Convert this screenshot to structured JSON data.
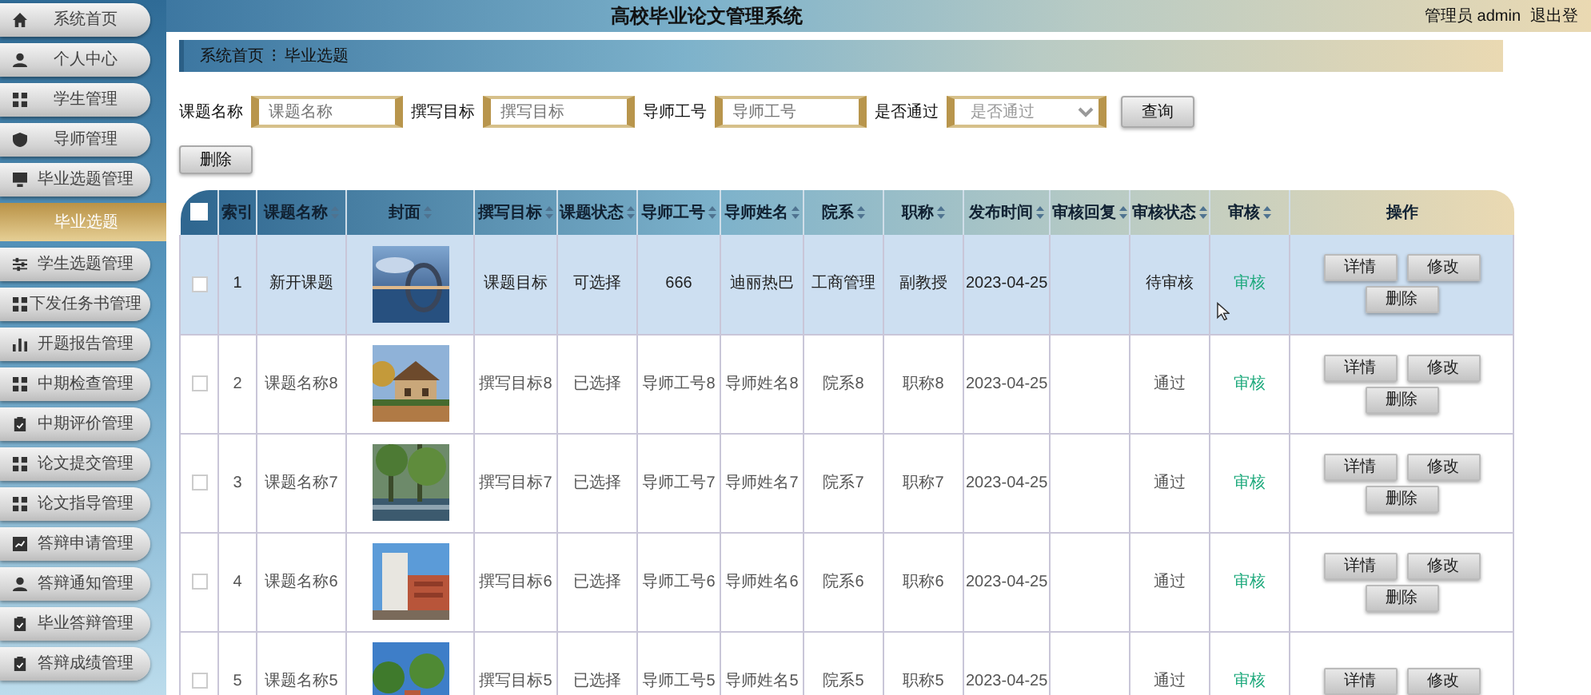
{
  "header": {
    "title": "高校毕业论文管理系统",
    "user": "管理员 admin",
    "logout": "退出登"
  },
  "sidebar": {
    "items": [
      {
        "label": "系统首页",
        "selected": false
      },
      {
        "label": "个人中心",
        "selected": false
      },
      {
        "label": "学生管理",
        "selected": false
      },
      {
        "label": "导师管理",
        "selected": false
      },
      {
        "label": "毕业选题管理",
        "selected": false
      },
      {
        "label": "毕业选题",
        "selected": true
      },
      {
        "label": "学生选题管理",
        "selected": false
      },
      {
        "label": "下发任务书管理",
        "selected": false
      },
      {
        "label": "开题报告管理",
        "selected": false
      },
      {
        "label": "中期检查管理",
        "selected": false
      },
      {
        "label": "中期评价管理",
        "selected": false
      },
      {
        "label": "论文提交管理",
        "selected": false
      },
      {
        "label": "论文指导管理",
        "selected": false
      },
      {
        "label": "答辩申请管理",
        "selected": false
      },
      {
        "label": "答辩通知管理",
        "selected": false
      },
      {
        "label": "毕业答辩管理",
        "selected": false
      },
      {
        "label": "答辩成绩管理",
        "selected": false
      }
    ]
  },
  "breadcrumb": {
    "items": [
      "系统首页",
      "毕业选题"
    ],
    "separator": "⁝"
  },
  "search": {
    "fields": [
      {
        "kind": "input",
        "label": "课题名称",
        "placeholder": "课题名称"
      },
      {
        "kind": "input",
        "label": "撰写目标",
        "placeholder": "撰写目标"
      },
      {
        "kind": "input",
        "label": "导师工号",
        "placeholder": "导师工号"
      },
      {
        "kind": "select",
        "label": "是否通过",
        "placeholder": "是否通过"
      }
    ],
    "button": "查询"
  },
  "delete_button": "删除",
  "table": {
    "header_checked": false,
    "columns": [
      {
        "kind": "checkbox"
      },
      {
        "kind": "text",
        "label": "索引",
        "sortable": false
      },
      {
        "kind": "text",
        "label": "课题名称",
        "sortable": true
      },
      {
        "kind": "picture",
        "label": "封面",
        "sortable": true
      },
      {
        "kind": "text",
        "label": "撰写目标",
        "sortable": true
      },
      {
        "kind": "text",
        "label": "课题状态",
        "sortable": true
      },
      {
        "kind": "text",
        "label": "导师工号",
        "sortable": true
      },
      {
        "kind": "text",
        "label": "导师姓名",
        "sortable": true
      },
      {
        "kind": "text",
        "label": "院系",
        "sortable": true
      },
      {
        "kind": "text",
        "label": "职称",
        "sortable": true
      },
      {
        "kind": "text",
        "label": "发布时间",
        "sortable": true
      },
      {
        "kind": "text",
        "label": "审核回复",
        "sortable": true
      },
      {
        "kind": "text",
        "label": "审核状态",
        "sortable": true
      },
      {
        "kind": "link",
        "label": "审核",
        "sortable": true
      },
      {
        "kind": "actions",
        "label": "操作",
        "sortable": false
      }
    ],
    "rows": [
      {
        "selected": true,
        "checked": false,
        "cells": [
          null,
          "1",
          "新开课题",
          {
            "kind": "picture"
          },
          "课题目标",
          "可选择",
          "666",
          "迪丽热巴",
          "工商管理",
          "副教授",
          "2023-04-25",
          null,
          "待审核",
          "审核",
          [
            "详情",
            "修改",
            "删除"
          ]
        ]
      },
      {
        "selected": false,
        "checked": false,
        "cells": [
          null,
          "2",
          "课题名称8",
          {
            "kind": "picture"
          },
          "撰写目标8",
          "已选择",
          "导师工号8",
          "导师姓名8",
          "院系8",
          "职称8",
          "2023-04-25",
          null,
          "通过",
          "审核",
          [
            "详情",
            "修改",
            "删除"
          ]
        ]
      },
      {
        "selected": false,
        "checked": false,
        "cells": [
          null,
          "3",
          "课题名称7",
          {
            "kind": "picture"
          },
          "撰写目标7",
          "已选择",
          "导师工号7",
          "导师姓名7",
          "院系7",
          "职称7",
          "2023-04-25",
          null,
          "通过",
          "审核",
          [
            "详情",
            "修改",
            "删除"
          ]
        ]
      },
      {
        "selected": false,
        "checked": false,
        "cells": [
          null,
          "4",
          "课题名称6",
          {
            "kind": "picture"
          },
          "撰写目标6",
          "已选择",
          "导师工号6",
          "导师姓名6",
          "院系6",
          "职称6",
          "2023-04-25",
          null,
          "通过",
          "审核",
          [
            "详情",
            "修改",
            "删除"
          ]
        ]
      },
      {
        "selected": false,
        "checked": false,
        "cells": [
          null,
          "5",
          "课题名称5",
          {
            "kind": "picture"
          },
          "撰写目标5",
          "已选择",
          "导师工号5",
          "导师姓名5",
          "院系5",
          "职称5",
          "2023-04-25",
          null,
          "通过",
          "审核",
          [
            "详情",
            "修改"
          ]
        ]
      }
    ]
  }
}
